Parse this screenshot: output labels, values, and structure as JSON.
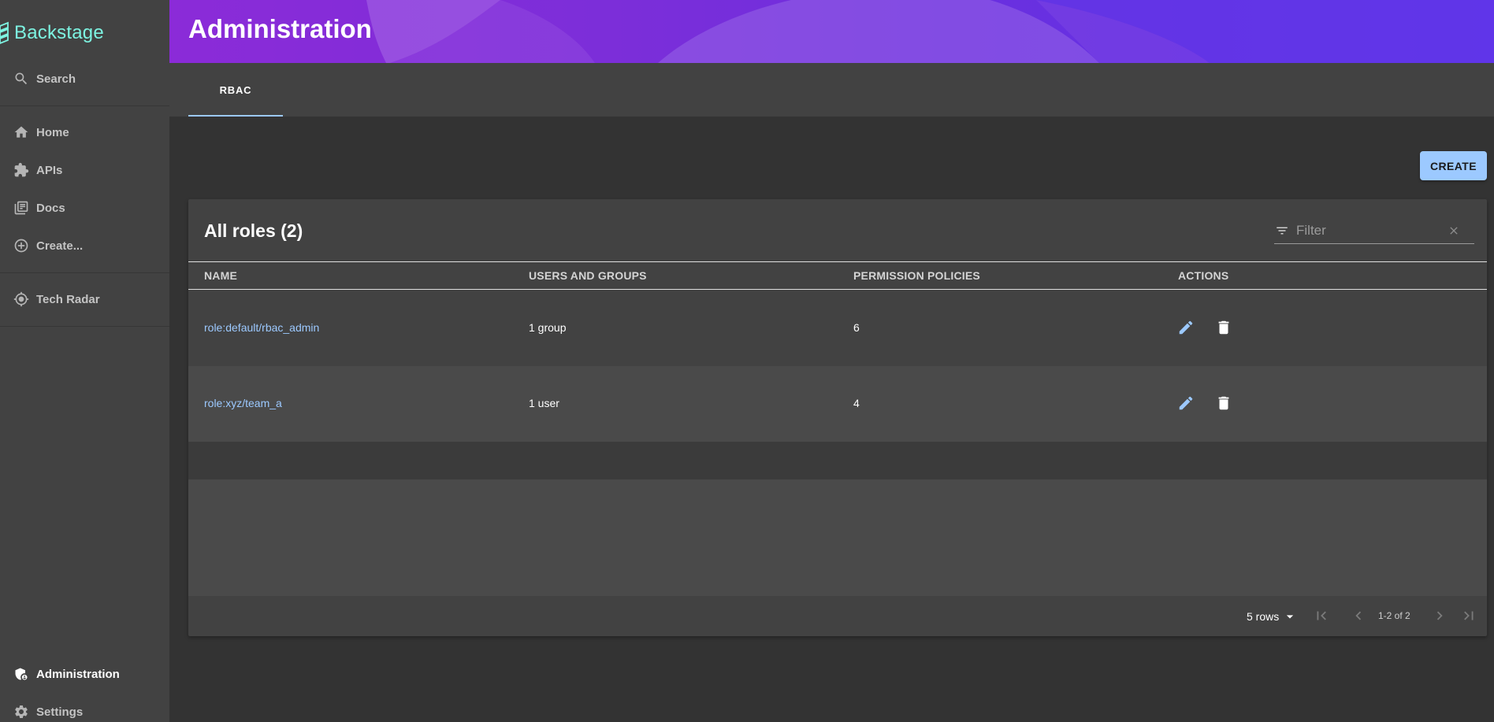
{
  "app": {
    "name": "Backstage"
  },
  "sidebar": {
    "search_label": "Search",
    "items": [
      {
        "label": "Home",
        "icon": "home-icon"
      },
      {
        "label": "APIs",
        "icon": "puzzle-icon"
      },
      {
        "label": "Docs",
        "icon": "library-books-icon"
      },
      {
        "label": "Create...",
        "icon": "add-circle-icon"
      },
      {
        "label": "Tech Radar",
        "icon": "radar-icon"
      }
    ],
    "bottom_items": [
      {
        "label": "Administration",
        "icon": "admin-icon",
        "active": true
      },
      {
        "label": "Settings",
        "icon": "gear-icon"
      }
    ]
  },
  "header": {
    "title": "Administration"
  },
  "tabs": [
    {
      "label": "RBAC",
      "active": true
    }
  ],
  "toolbar": {
    "create_label": "CREATE"
  },
  "table": {
    "title": "All roles (2)",
    "filter_placeholder": "Filter",
    "columns": [
      "NAME",
      "USERS AND GROUPS",
      "PERMISSION POLICIES",
      "ACTIONS"
    ],
    "rows": [
      {
        "name": "role:default/rbac_admin",
        "users_groups": "1 group",
        "policies": "6"
      },
      {
        "name": "role:xyz/team_a",
        "users_groups": "1 user",
        "policies": "4"
      }
    ],
    "pagination": {
      "rows_per_page": "5 rows",
      "range": "1-2 of 2"
    }
  },
  "colors": {
    "accent": "#9cc9ff",
    "logo": "#7df3e1",
    "sidebar": "#424242",
    "background": "#333333",
    "delete_icon": "#ffffff"
  }
}
